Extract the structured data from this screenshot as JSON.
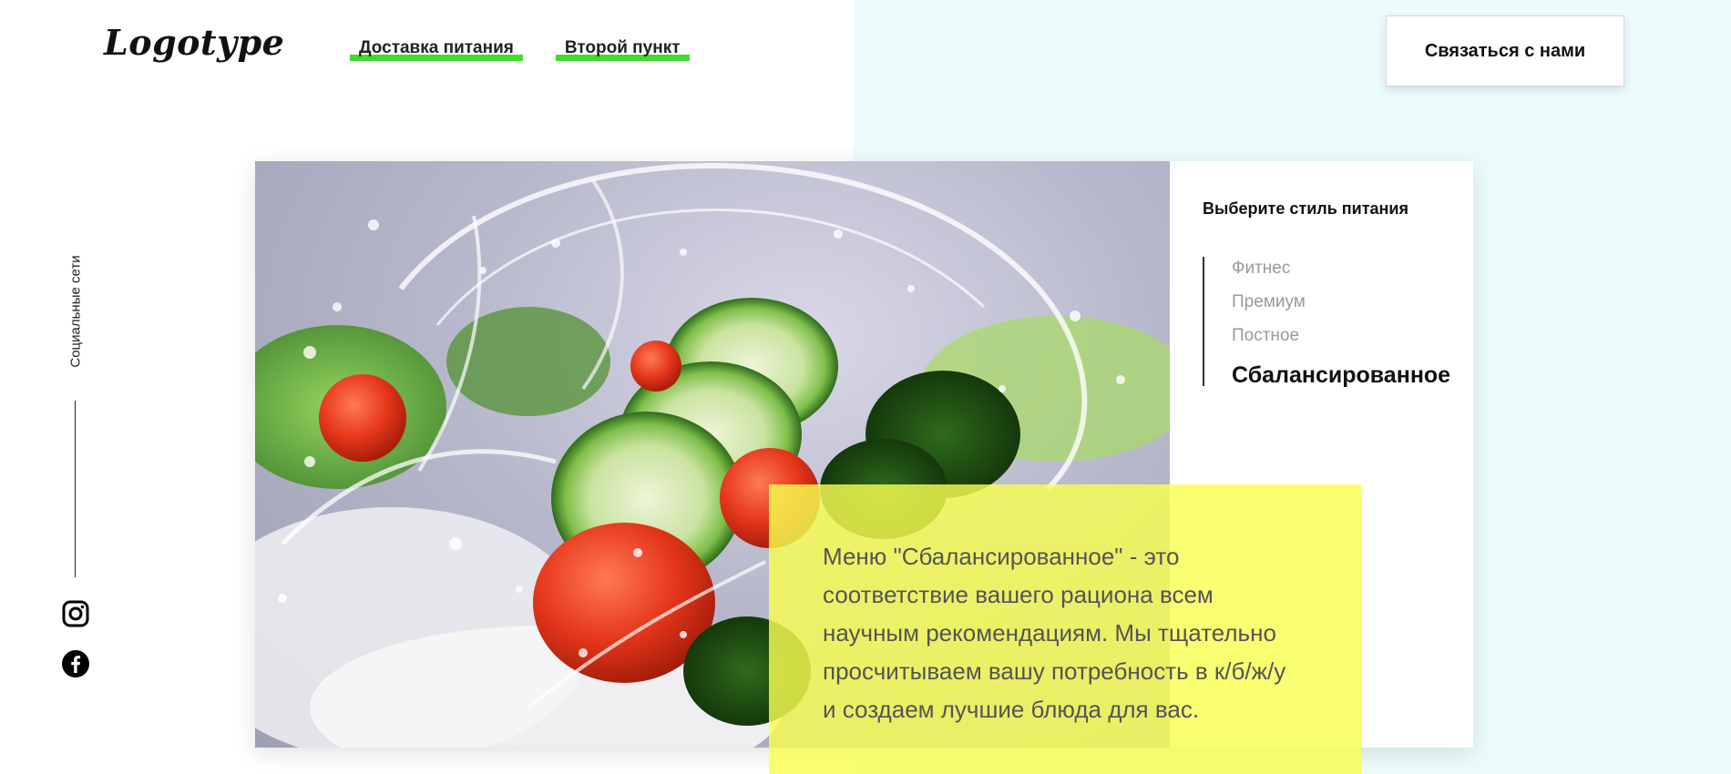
{
  "header": {
    "logo": "Logotype",
    "nav": [
      "Доставка питания",
      "Второй пункт"
    ],
    "contact_button": "Связаться с нами"
  },
  "social": {
    "label": "Социальные сети",
    "icons": [
      "instagram-icon",
      "facebook-icon"
    ]
  },
  "menu": {
    "title": "Выберите стиль питания",
    "items": [
      "Фитнес",
      "Премиум",
      "Постное",
      "Сбалансированное"
    ],
    "active_item": "Сбалансированное"
  },
  "description": "Меню \"Сбалансированное\" - это соответствие вашего рациона всем научным рекомендациям. Мы тщательно просчитываем вашу потребность в к/б/ж/у и создаем лучшие блюда для вас.",
  "colors": {
    "accent_green": "#3fdc2a",
    "highlight_yellow": "#f8ff50",
    "right_background": "#ecfcfc"
  }
}
